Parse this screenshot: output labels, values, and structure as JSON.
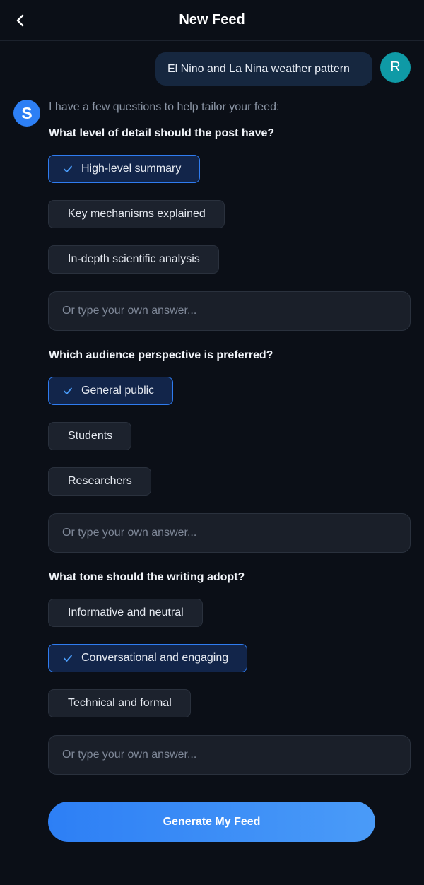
{
  "header": {
    "title": "New Feed",
    "back_icon": "chevron-left-icon"
  },
  "user_message": {
    "text": "El Nino and La Nina weather pattern",
    "avatar_initial": "R",
    "avatar_color": "#0f9aa6"
  },
  "bot": {
    "avatar_letter": "S",
    "avatar_color": "#2d7ff5",
    "intro": "I have a few questions to help tailor your feed:"
  },
  "questions": [
    {
      "prompt": "What level of detail should the post have?",
      "options": [
        {
          "label": "High-level summary",
          "selected": true
        },
        {
          "label": "Key mechanisms explained",
          "selected": false
        },
        {
          "label": "In-depth scientific analysis",
          "selected": false
        }
      ],
      "placeholder": "Or type your own answer..."
    },
    {
      "prompt": "Which audience perspective is preferred?",
      "options": [
        {
          "label": "General public",
          "selected": true
        },
        {
          "label": "Students",
          "selected": false
        },
        {
          "label": "Researchers",
          "selected": false
        }
      ],
      "placeholder": "Or type your own answer..."
    },
    {
      "prompt": "What tone should the writing adopt?",
      "options": [
        {
          "label": "Informative and neutral",
          "selected": false
        },
        {
          "label": "Conversational and engaging",
          "selected": true
        },
        {
          "label": "Technical and formal",
          "selected": false
        }
      ],
      "placeholder": "Or type your own answer..."
    }
  ],
  "generate_button": {
    "label": "Generate My Feed"
  },
  "colors": {
    "accent": "#2d7ff5",
    "background": "#0b0f17",
    "chip": "#1c222d",
    "chip_selected": "#12254a"
  }
}
